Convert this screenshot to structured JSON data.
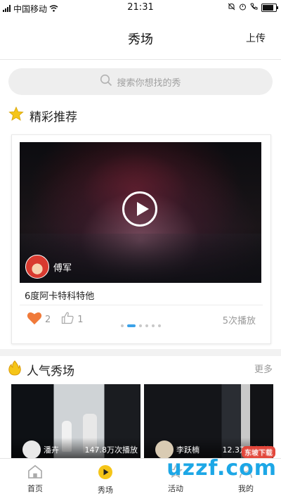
{
  "status_bar": {
    "carrier": "中国移动",
    "time": "21:31"
  },
  "header": {
    "title": "秀场",
    "upload_label": "上传"
  },
  "search": {
    "placeholder": "搜索你想找的秀"
  },
  "recommend": {
    "heading": "精彩推荐",
    "card": {
      "author": "傅军",
      "title": "6度阿卡特科特他",
      "likes": "2",
      "thumbs": "1",
      "plays": "5次播放"
    },
    "carousel_pages": 6,
    "carousel_active": 1
  },
  "popular": {
    "heading": "人气秀场",
    "more_label": "更多",
    "items": [
      {
        "name": "潘卉",
        "plays": "147.8万次播放"
      },
      {
        "name": "李跃楠",
        "plays": "12.3万次播放"
      }
    ]
  },
  "tabs": [
    {
      "label": "首页",
      "icon": "home-icon"
    },
    {
      "label": "秀场",
      "icon": "showroom-icon"
    },
    {
      "label": "活动",
      "icon": "activity-icon"
    },
    {
      "label": "我的",
      "icon": "profile-icon"
    }
  ],
  "watermark": {
    "text": "uzzf.com",
    "sub": "东坡下载"
  },
  "colors": {
    "accent_yellow": "#f5c518",
    "heart": "#f07a3a",
    "dot_active": "#3aa1e8"
  }
}
